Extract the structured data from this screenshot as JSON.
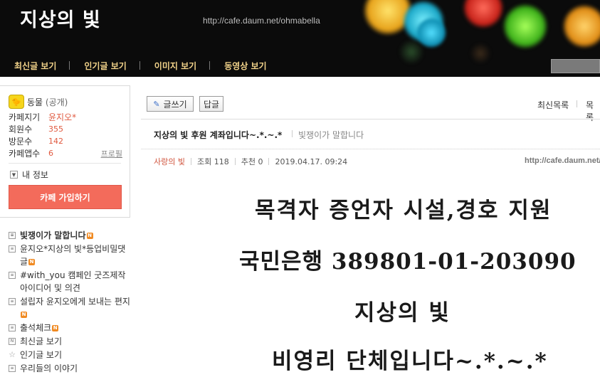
{
  "header": {
    "title": "지상의 빛",
    "url": "http://cafe.daum.net/ohmabella",
    "nav": [
      "최신글 보기",
      "인기글 보기",
      "이미지 보기",
      "동영상 보기"
    ]
  },
  "sidebar": {
    "category": "동물",
    "visibility": "(공개)",
    "stats": [
      {
        "label": "카페지기",
        "value": "윤지오*"
      },
      {
        "label": "회원수",
        "value": "355"
      },
      {
        "label": "방문수",
        "value": "142"
      },
      {
        "label": "카페앱수",
        "value": "6"
      }
    ],
    "profile_link": "프로필",
    "my_info": "내 정보",
    "join_button": "카페 가입하기",
    "menu": [
      {
        "label": "빛쟁이가 말합니다",
        "new": true,
        "bold": true,
        "icon": "board-icon"
      },
      {
        "label": "윤지오*지상의 빛*등업비밀댓글",
        "new": true,
        "bold": false,
        "icon": "board-icon"
      },
      {
        "label": "#with_you 캠페인 굿즈제작 아이디어 및 의견",
        "new": false,
        "bold": false,
        "icon": "board-icon"
      },
      {
        "label": "설립자 윤지오에게 보내는 편지",
        "new": true,
        "bold": false,
        "icon": "board-icon"
      },
      {
        "label": "출석체크",
        "new": true,
        "bold": false,
        "icon": "board-icon"
      },
      {
        "label": "최신글 보기",
        "new": false,
        "bold": false,
        "icon": "new-posts-icon"
      },
      {
        "label": "인기글 보기",
        "new": false,
        "bold": false,
        "icon": "star-icon"
      },
      {
        "label": "우리들의 이야기",
        "new": false,
        "bold": false,
        "icon": "board-icon"
      }
    ],
    "new_badge": "N"
  },
  "toolbar": {
    "write": "글쓰기",
    "reply": "답글",
    "latest_list": "최신목록",
    "list": "목록"
  },
  "post": {
    "title": "지상의 빛 후원 계좌입니다~.*.~.*",
    "board": "빛쟁이가 말합니다",
    "author": "사랑의 빛",
    "views": "조회 118",
    "likes": "추천 0",
    "date": "2019.04.17. 09:24",
    "url": "http://cafe.daum.net/",
    "body": [
      "목격자 증언자 시설,경호 지원",
      "국민은행 389801-01-203090",
      "지상의 빛",
      "비영리 단체입니다~.*.~.*"
    ]
  },
  "colors": {
    "accent": "#f36b5b",
    "nav_text": "#f2d38a",
    "stat_value": "#e0593f",
    "new_badge": "#f08a22"
  }
}
